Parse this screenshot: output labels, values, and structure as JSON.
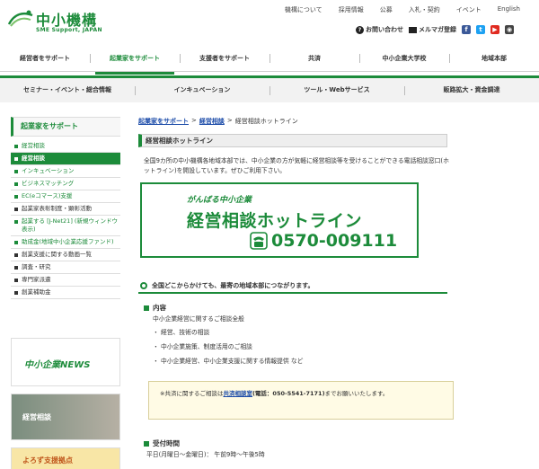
{
  "header": {
    "logo_text": "中小機構",
    "logo_sub": "SME Support, JAPAN",
    "top_links": [
      "機構について",
      "採用情報",
      "公募",
      "入札・契約",
      "イベント",
      "English"
    ],
    "inquiry_label": "お問い合わせ",
    "mailmag_label": "メルマガ登録"
  },
  "main_nav": [
    {
      "label": "経営者をサポート"
    },
    {
      "label": "起業家をサポート"
    },
    {
      "label": "支援者をサポート"
    },
    {
      "label": "共済"
    },
    {
      "label": "中小企業大学校"
    },
    {
      "label": "地域本部"
    }
  ],
  "sec_nav": [
    {
      "label": "セミナー・イベント・総合情報"
    },
    {
      "label": "インキュベーション"
    },
    {
      "label": "ツール・Webサービス"
    },
    {
      "label": "販路拡大・資金調達"
    }
  ],
  "sidebar": {
    "title": "起業家をサポート",
    "items": [
      {
        "label": "経営相談"
      },
      {
        "label": "経営相談"
      },
      {
        "label": "インキュベーション"
      },
      {
        "label": "ビジネスマッチング"
      },
      {
        "label": "EC(eコマース)支援"
      },
      {
        "label": "起業家表彰制度・顕彰活動"
      },
      {
        "label": "起業する [J-Net21] (新規ウィンドウ表示)"
      },
      {
        "label": "助成金(地域中小企業応援ファンド)"
      },
      {
        "label": "創業支援に関する動画一覧"
      },
      {
        "label": "調査・研究"
      },
      {
        "label": "専門家派遣"
      },
      {
        "label": "創業補助金"
      }
    ],
    "banner_news": "中小企業NEWS",
    "banner_keiei": "経営相談",
    "banner_yoro": "よろず支援拠点"
  },
  "breadcrumb": [
    "起業家をサポート",
    "経営相談",
    "経営相談ホットライン"
  ],
  "page_title": "経営相談ホットライン",
  "intro": "全国9カ所の中小機構各地域本部では、中小企業の方が気軽に経営相談等を受けることができる電話相談窓口(ホットライン)を開設しています。ぜひご利用下さい。",
  "hotline": {
    "sub": "がんばる中小企業",
    "main": "経営相談ホットライン",
    "phone": "0570-009111"
  },
  "green_box": "全国どこからかけても、最寄の地域本部につながります。",
  "content": {
    "heading": "内容",
    "desc": "中小企業経営に関するご相談全般",
    "bullets": [
      "経営、技術の相談",
      "中小企業施策、制度活用のご相談",
      "中小企業経営、中小企業支援に関する情報提供 など"
    ]
  },
  "notice": {
    "pre": "※共済に関するご相談は",
    "link": "共済相談室",
    "tel": "(電話：050-5541-7171)",
    "post": "までお願いいたします。"
  },
  "hours": {
    "heading": "受付時間",
    "text": "平日(月曜日～金曜日)： 午前9時～午後5時"
  }
}
